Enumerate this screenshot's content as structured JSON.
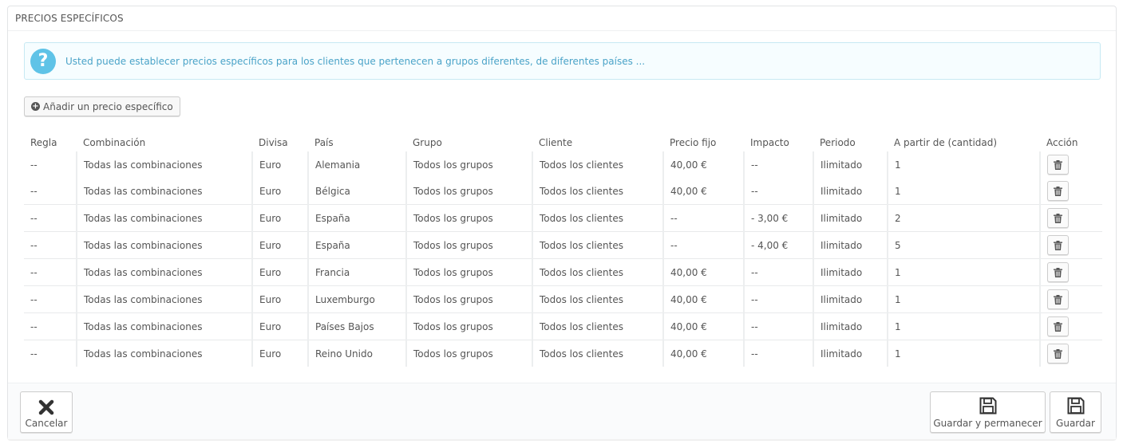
{
  "panel": {
    "title": "PRECIOS ESPECÍFICOS"
  },
  "alert": {
    "icon": "question-circle-icon",
    "icon_glyph": "?",
    "text": "Usted puede establecer precios específicos para los clientes que pertenecen a grupos diferentes, de diferentes países ..."
  },
  "add_button": {
    "icon": "plus-circle-icon",
    "label": "Añadir un precio específico"
  },
  "table": {
    "headers": {
      "regla": "Regla",
      "combinacion": "Combinación",
      "divisa": "Divisa",
      "pais": "País",
      "grupo": "Grupo",
      "cliente": "Cliente",
      "precio_fijo": "Precio fijo",
      "impacto": "Impacto",
      "periodo": "Periodo",
      "cantidad": "A partir de (cantidad)",
      "accion": "Acción"
    },
    "rows": [
      {
        "regla": "--",
        "combinacion": "Todas las combinaciones",
        "divisa": "Euro",
        "pais": "Alemania",
        "grupo": "Todos los grupos",
        "cliente": "Todos los clientes",
        "precio_fijo": "40,00 €",
        "impacto": "--",
        "periodo": "Ilimitado",
        "cantidad": "1"
      },
      {
        "regla": "--",
        "combinacion": "Todas las combinaciones",
        "divisa": "Euro",
        "pais": "Bélgica",
        "grupo": "Todos los grupos",
        "cliente": "Todos los clientes",
        "precio_fijo": "40,00 €",
        "impacto": "--",
        "periodo": "Ilimitado",
        "cantidad": "1"
      },
      {
        "regla": "--",
        "combinacion": "Todas las combinaciones",
        "divisa": "Euro",
        "pais": "España",
        "grupo": "Todos los grupos",
        "cliente": "Todos los clientes",
        "precio_fijo": "--",
        "impacto": "- 3,00 €",
        "periodo": "Ilimitado",
        "cantidad": "2"
      },
      {
        "regla": "--",
        "combinacion": "Todas las combinaciones",
        "divisa": "Euro",
        "pais": "España",
        "grupo": "Todos los grupos",
        "cliente": "Todos los clientes",
        "precio_fijo": "--",
        "impacto": "- 4,00 €",
        "periodo": "Ilimitado",
        "cantidad": "5"
      },
      {
        "regla": "--",
        "combinacion": "Todas las combinaciones",
        "divisa": "Euro",
        "pais": "Francia",
        "grupo": "Todos los grupos",
        "cliente": "Todos los clientes",
        "precio_fijo": "40,00 €",
        "impacto": "--",
        "periodo": "Ilimitado",
        "cantidad": "1"
      },
      {
        "regla": "--",
        "combinacion": "Todas las combinaciones",
        "divisa": "Euro",
        "pais": "Luxemburgo",
        "grupo": "Todos los grupos",
        "cliente": "Todos los clientes",
        "precio_fijo": "40,00 €",
        "impacto": "--",
        "periodo": "Ilimitado",
        "cantidad": "1"
      },
      {
        "regla": "--",
        "combinacion": "Todas las combinaciones",
        "divisa": "Euro",
        "pais": "Países Bajos",
        "grupo": "Todos los grupos",
        "cliente": "Todos los clientes",
        "precio_fijo": "40,00 €",
        "impacto": "--",
        "periodo": "Ilimitado",
        "cantidad": "1"
      },
      {
        "regla": "--",
        "combinacion": "Todas las combinaciones",
        "divisa": "Euro",
        "pais": "Reino Unido",
        "grupo": "Todos los grupos",
        "cliente": "Todos los clientes",
        "precio_fijo": "40,00 €",
        "impacto": "--",
        "periodo": "Ilimitado",
        "cantidad": "1"
      }
    ],
    "row_action_icon": "trash-icon"
  },
  "footer": {
    "cancel": {
      "icon": "close-icon",
      "label": "Cancelar"
    },
    "save_stay": {
      "icon": "floppy-disk-icon",
      "label": "Guardar y permanecer"
    },
    "save": {
      "icon": "floppy-disk-icon",
      "label": "Guardar"
    }
  },
  "colors": {
    "alert_bg": "#f6fdff",
    "alert_border": "#c7e9f3",
    "alert_text": "#4aa3c8",
    "alert_icon": "#5fc3e7",
    "text": "#555555"
  }
}
